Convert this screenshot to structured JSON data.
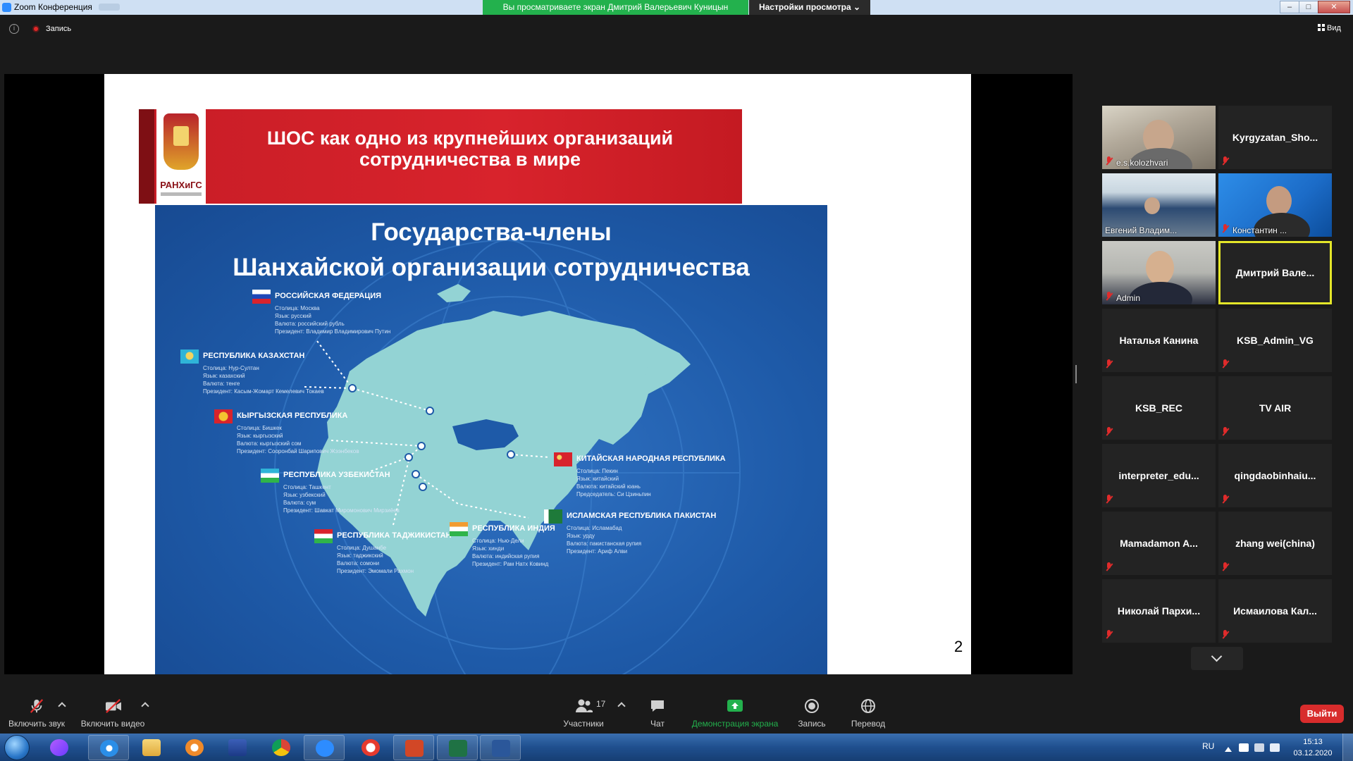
{
  "window": {
    "title": "Zoom Конференция",
    "viewing_banner": "Вы просматриваете экран Дмитрий Валерьевич Куницын",
    "view_options": "Настройки просмотра ⌄"
  },
  "top_bar": {
    "recording_label": "Запись",
    "view_label": "Вид"
  },
  "slide": {
    "logo_text": "РАНХиГС",
    "title_line1": "ШОС как одно из крупнейших организаций",
    "title_line2": "сотрудничества в мире",
    "map_title_line1": "Государства-члены",
    "map_title_line2": "Шанхайской организации сотрудничества",
    "page_number": "2",
    "countries": [
      {
        "name": "РОССИЙСКАЯ ФЕДЕРАЦИЯ",
        "lines": [
          "Столица: Москва",
          "Язык: русский",
          "Валюта: российский рубль",
          "Президент: Владимир Владимирович Путин"
        ]
      },
      {
        "name": "РЕСПУБЛИКА КАЗАХСТАН",
        "lines": [
          "Столица: Нур-Султан",
          "Язык: казахский",
          "Валюта: тенге",
          "Президент: Касым-Жомарт Кемелевич Токаев"
        ]
      },
      {
        "name": "КЫРГЫЗСКАЯ РЕСПУБЛИКА",
        "lines": [
          "Столица: Бишкек",
          "Язык: кыргызский",
          "Валюта: кыргызский сом",
          "Президент: Сооронбай Шарипович Жээнбеков"
        ]
      },
      {
        "name": "РЕСПУБЛИКА УЗБЕКИСТАН",
        "lines": [
          "Столица: Ташкент",
          "Язык: узбекский",
          "Валюта: сум",
          "Президент: Шавкат Миромонович Мирзиёев"
        ]
      },
      {
        "name": "РЕСПУБЛИКА ТАДЖИКИСТАН",
        "lines": [
          "Столица: Душанбе",
          "Язык: таджикский",
          "Валюта: сомони",
          "Президент: Эмомали Рахмон"
        ]
      },
      {
        "name": "РЕСПУБЛИКА ИНДИЯ",
        "lines": [
          "Столица: Нью-Дели",
          "Язык: хинди",
          "Валюта: индийская рупия",
          "Президент: Рам Натх Ковинд"
        ]
      },
      {
        "name": "КИТАЙСКАЯ НАРОДНАЯ РЕСПУБЛИКА",
        "lines": [
          "Столица: Пекин",
          "Язык: китайский",
          "Валюта: китайский юань",
          "Председатель: Си Цзиньпин"
        ]
      },
      {
        "name": "ИСЛАМСКАЯ РЕСПУБЛИКА ПАКИСТАН",
        "lines": [
          "Столица: Исламабад",
          "Язык: урду",
          "Валюта: пакистанская рупия",
          "Президент: Ариф Алви"
        ]
      }
    ]
  },
  "gallery": [
    {
      "name": "e.s.kolozhvari",
      "video": true
    },
    {
      "name": "Kyrgyzatan_Sho...",
      "video": false
    },
    {
      "name": "Евгений Владим...",
      "video": true
    },
    {
      "name": "Константин ...",
      "video": true
    },
    {
      "name": "Admin",
      "video": true
    },
    {
      "name": "Дмитрий  Вале...",
      "video": false,
      "active": true
    },
    {
      "name": "Наталья Канина",
      "video": false
    },
    {
      "name": "KSB_Admin_VG",
      "video": false
    },
    {
      "name": "KSB_REC",
      "video": false
    },
    {
      "name": "TV AIR",
      "video": false
    },
    {
      "name": "interpreter_edu...",
      "video": false
    },
    {
      "name": "qingdaobinhaiu...",
      "video": false
    },
    {
      "name": "Mamadamon  A...",
      "video": false
    },
    {
      "name": "zhang wei(china)",
      "video": false
    },
    {
      "name": "Николай  Пархи...",
      "video": false
    },
    {
      "name": "Исмаилова  Кал...",
      "video": false
    }
  ],
  "toolbar": {
    "unmute": "Включить звук",
    "start_video": "Включить видео",
    "participants_count": "17",
    "participants": "Участники",
    "chat": "Чат",
    "share_screen": "Демонстрация экрана",
    "record": "Запись",
    "translate": "Перевод",
    "leave": "Выйти"
  },
  "taskbar": {
    "lang": "RU",
    "time": "15:13",
    "date": "03.12.2020"
  },
  "colors": {
    "zoom_blue": "#2d8cff",
    "banner_green": "#23b14d",
    "slide_red": "#d8232c",
    "map_blue": "#1e5aa8",
    "land": "#93d3d4",
    "active_speaker": "#e4e629",
    "leave_red": "#d82c2c"
  }
}
